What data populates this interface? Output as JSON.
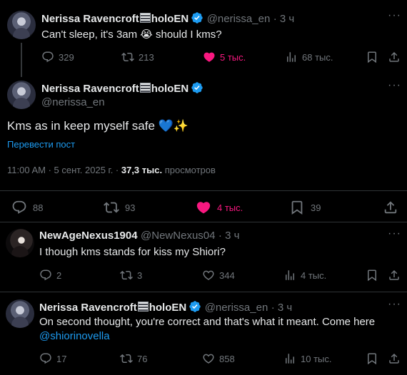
{
  "tweet1": {
    "name": "Nerissa Ravencroft",
    "name_suffix": "holoEN",
    "handle": "@nerissa_en",
    "time": "· 3 ч",
    "text": "Can't sleep, it's 3am",
    "emoji": "😭",
    "text_after": " should I kms?",
    "replies": "329",
    "retweets": "213",
    "likes": "5 тыс.",
    "views": "68 тыс."
  },
  "main": {
    "name": "Nerissa Ravencroft",
    "name_suffix": "holoEN",
    "handle": "@nerissa_en",
    "text": "Kms as in keep myself safe ",
    "emoji": "💙✨",
    "translate": "Перевести пост",
    "timestamp": "11:00 AM · 5 сент. 2025 г. · ",
    "views_count": "37,3 тыс.",
    "views_label": " просмотров",
    "replies": "88",
    "retweets": "93",
    "likes": "4 тыс.",
    "bookmarks": "39"
  },
  "reply1": {
    "name": "NewAgeNexus1904",
    "handle": "@NewNexus04",
    "time": "· 3 ч",
    "text": "I though kms stands for kiss my Shiori?",
    "replies": "2",
    "retweets": "3",
    "likes": "344",
    "views": "4 тыс."
  },
  "reply2": {
    "name": "Nerissa Ravencroft",
    "name_suffix": "holoEN",
    "handle": "@nerissa_en",
    "time": "· 3 ч",
    "text": "On second thought, you're correct and that's what it meant. Come here",
    "mention": "@shiorinovella",
    "replies": "17",
    "retweets": "76",
    "likes": "858",
    "views": "10 тыс."
  },
  "colors": {
    "background": "#000000",
    "text": "#e7e9ea",
    "muted": "#71767b",
    "accent": "#1d9bf0",
    "like": "#f91880"
  }
}
